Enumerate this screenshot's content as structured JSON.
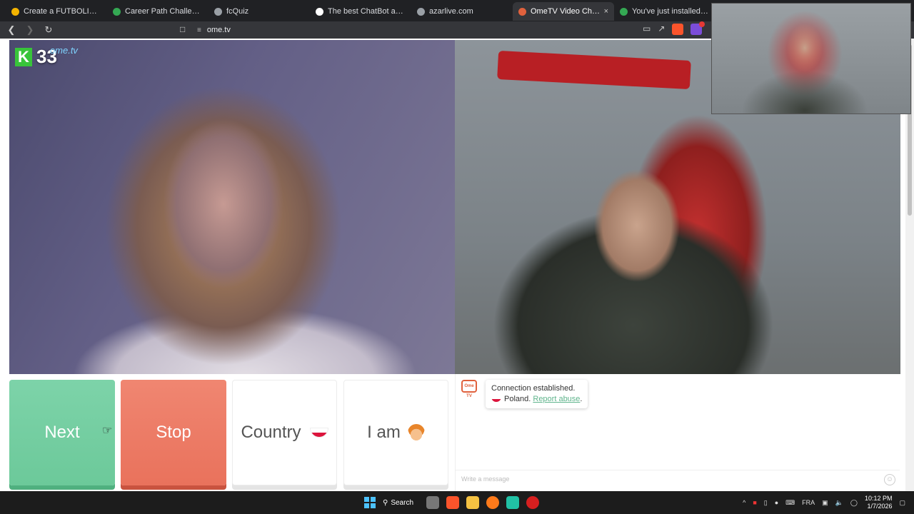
{
  "browser": {
    "tabs": [
      {
        "label": "Create a FUTBOLISTAS DEL SIG",
        "color": "#f4b400"
      },
      {
        "label": "Career Path Challenge - Footb",
        "color": "#34a853"
      },
      {
        "label": "fcQuiz",
        "color": "#9aa0a6"
      },
      {
        "label": "The best ChatBot and Widgets",
        "color": "#ffffff"
      },
      {
        "label": "azarlive.com",
        "color": "#9aa0a6"
      },
      {
        "label": "OmeTV Video Chat —",
        "color": "#e0613d",
        "active": true
      },
      {
        "label": "You've just installed Browsec",
        "color": "#34a853"
      }
    ],
    "close_glyph": "×",
    "address": "ome.tv",
    "icons": [
      "back-icon",
      "forward-icon",
      "reload-icon",
      "bookmark-icon",
      "tune-icon",
      "cast-icon",
      "share-icon",
      "brave-shield-icon",
      "rewards-icon"
    ]
  },
  "overlay": {
    "logo_letter": "K",
    "counter": "33",
    "brand": "ome.tv"
  },
  "controls": {
    "next": "Next",
    "stop": "Stop",
    "country": "Country",
    "iam": "I am"
  },
  "chat": {
    "logo_text": "Ome TV",
    "status": "Connection established.",
    "country": "Poland.",
    "report": "Report abuse",
    "report_suffix": ".",
    "placeholder": "Write a message"
  },
  "taskbar": {
    "search": "Search",
    "lang": "FRA",
    "time": "10:12 PM",
    "date": "1/7/2026",
    "accent": "#4cc2ff"
  }
}
